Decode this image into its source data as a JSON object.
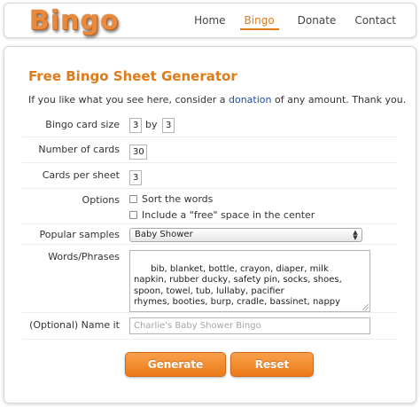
{
  "header": {
    "logo_text": "Bingo",
    "nav": [
      {
        "label": "Home"
      },
      {
        "label": "Bingo",
        "active": true
      },
      {
        "label": "Donate"
      },
      {
        "label": "Contact"
      }
    ]
  },
  "form": {
    "title": "Free Bingo Sheet Generator",
    "intro_before": "If you like what you see here, consider a ",
    "intro_link": "donation",
    "intro_after": " of any amount. Thank you.",
    "card_size": {
      "label": "Bingo card size",
      "rows": "3",
      "by": "by",
      "cols": "3"
    },
    "num_cards": {
      "label": "Number of cards",
      "value": "30"
    },
    "cards_per_sheet": {
      "label": "Cards per sheet",
      "value": "3"
    },
    "options": {
      "label": "Options",
      "sort_words": "Sort the words",
      "free_space": "Include a \"free\" space in the center"
    },
    "popular_samples": {
      "label": "Popular samples",
      "selected": "Baby Shower"
    },
    "words": {
      "label": "Words/Phrases",
      "value": "bib, blanket, bottle, crayon, diaper, milk\nnapkin, rubber ducky, safety pin, socks, shoes,\nspoon, towel, tub, lullaby, pacifier\nrhymes, booties, burp, cradle, bassinet, nappy"
    },
    "name_it": {
      "label": "(Optional) Name it",
      "placeholder": "Charlie's Baby Shower Bingo"
    },
    "generate_label": "Generate",
    "reset_label": "Reset"
  },
  "colors": {
    "accent": "#e07b18",
    "link": "#1f4fa8",
    "button": "#ec7a1a"
  }
}
